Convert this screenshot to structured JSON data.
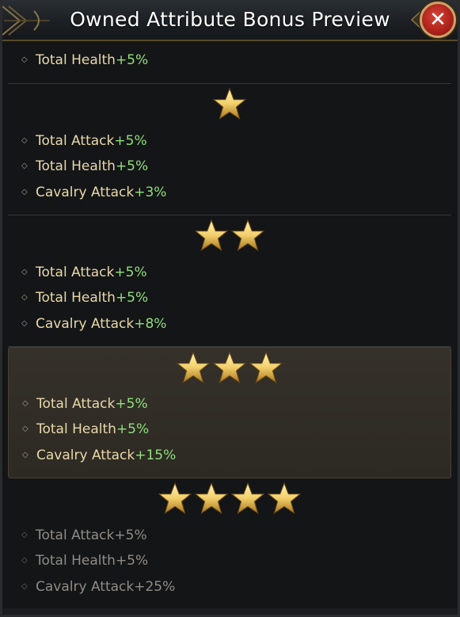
{
  "header": {
    "title": "Owned Attribute Bonus Preview",
    "close_label": "✕"
  },
  "sections": [
    {
      "stars": 0,
      "rows": [
        {
          "name": "Total Health",
          "value": "+5%"
        }
      ]
    },
    {
      "stars": 1,
      "rows": [
        {
          "name": "Total Attack",
          "value": "+5%"
        },
        {
          "name": "Total Health",
          "value": "+5%"
        },
        {
          "name": "Cavalry Attack",
          "value": "+3%"
        }
      ]
    },
    {
      "stars": 2,
      "rows": [
        {
          "name": "Total Attack",
          "value": "+5%"
        },
        {
          "name": "Total Health",
          "value": "+5%"
        },
        {
          "name": "Cavalry Attack",
          "value": "+8%"
        }
      ]
    },
    {
      "stars": 3,
      "highlighted": true,
      "rows": [
        {
          "name": "Total Attack",
          "value": "+5%"
        },
        {
          "name": "Total Health",
          "value": "+5%"
        },
        {
          "name": "Cavalry Attack",
          "value": "+15%"
        }
      ]
    },
    {
      "stars": 4,
      "locked": true,
      "rows": [
        {
          "name": "Total Attack",
          "value": "+5%"
        },
        {
          "name": "Total Health",
          "value": "+5%"
        },
        {
          "name": "Cavalry Attack",
          "value": "+25%"
        }
      ]
    }
  ],
  "colors": {
    "attribute_name": "#e8d9a9",
    "bonus_value": "#8fe07a",
    "locked_text": "#8f8c86",
    "star_gold": "#f2cf6a",
    "close_red": "#b0231b"
  },
  "icons": {
    "star": "star-icon",
    "bullet": "diamond-bullet-icon",
    "close": "close-icon"
  }
}
